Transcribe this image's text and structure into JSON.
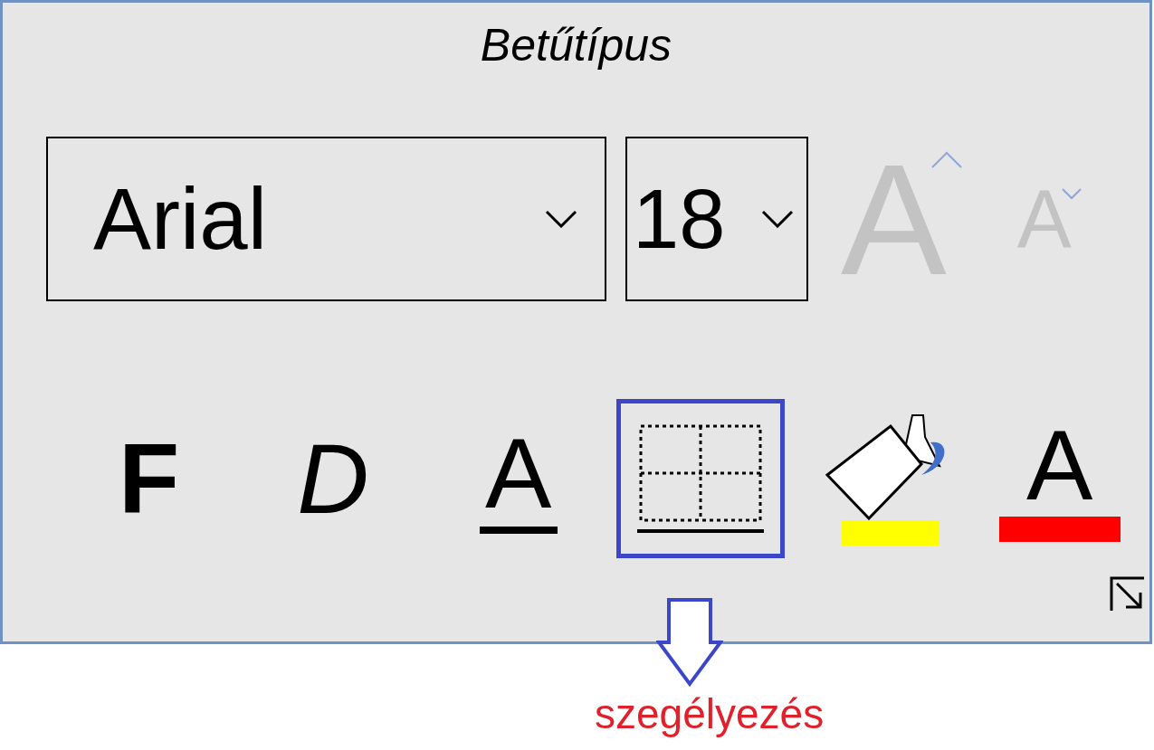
{
  "group": {
    "title": "Betűtípus"
  },
  "font_name": {
    "value": "Arial"
  },
  "font_size": {
    "value": "18"
  },
  "size_buttons": [
    {
      "kind": "grow",
      "label": "A",
      "disabled": true
    },
    {
      "kind": "shrink",
      "label": "A",
      "disabled": true
    }
  ],
  "format_buttons": [
    {
      "kind": "bold",
      "label": "F",
      "selected": false
    },
    {
      "kind": "italic",
      "label": "D",
      "selected": false
    },
    {
      "kind": "underline",
      "label": "A",
      "selected": false
    },
    {
      "kind": "borders",
      "selected": true
    },
    {
      "kind": "fill",
      "selected": false,
      "color": "#ffff00"
    },
    {
      "kind": "font-color",
      "label": "A",
      "selected": false,
      "color": "#ff0000"
    }
  ],
  "annotation": {
    "text": "szegélyezés"
  }
}
